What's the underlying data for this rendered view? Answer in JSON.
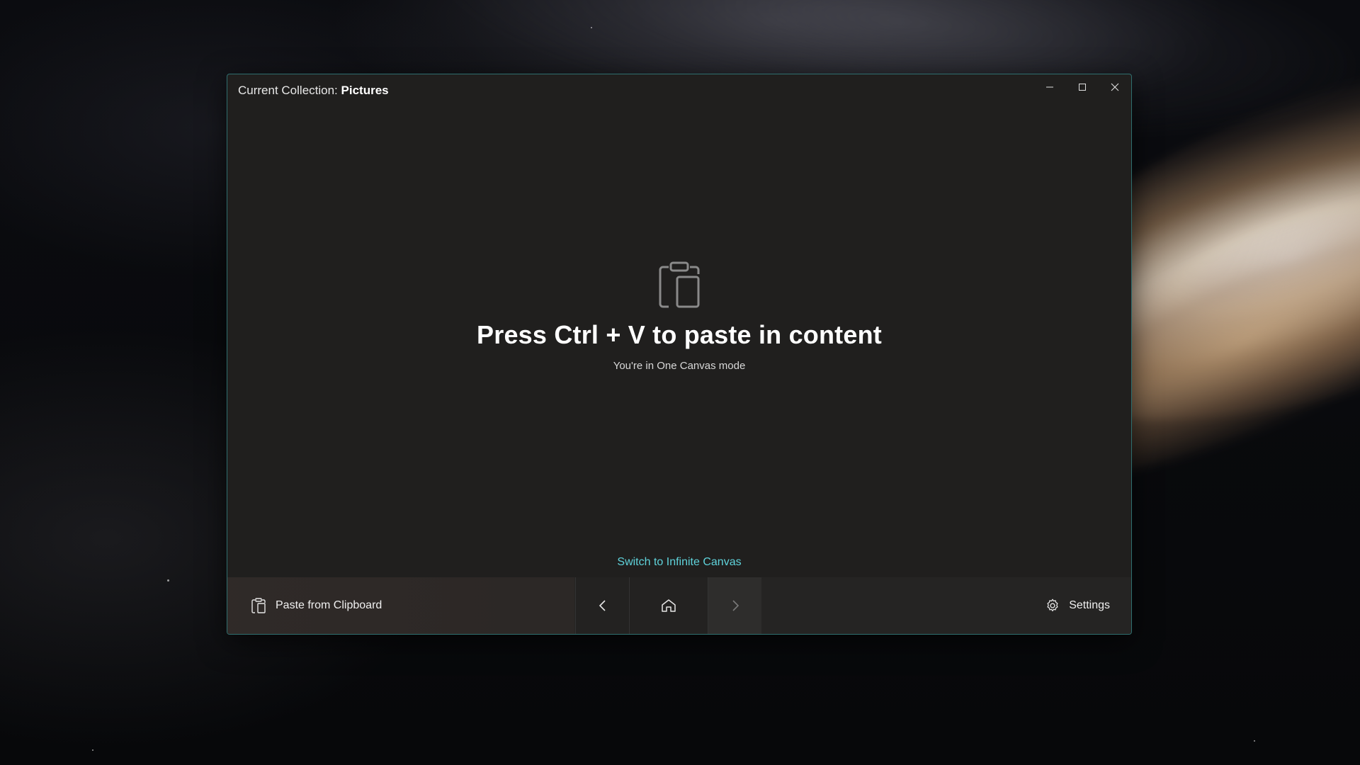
{
  "window": {
    "title_prefix": "Current Collection:",
    "title_collection": "Pictures"
  },
  "caption": {
    "minimize_icon": "minimize-icon",
    "maximize_icon": "maximize-icon",
    "close_icon": "close-icon"
  },
  "empty_state": {
    "icon": "clipboard-icon",
    "headline": "Press Ctrl + V to paste in content",
    "subline": "You're in One Canvas mode",
    "switch_link": "Switch to Infinite Canvas"
  },
  "bottombar": {
    "paste_label": "Paste from Clipboard",
    "paste_icon": "clipboard-icon",
    "back_icon": "chevron-left-icon",
    "home_icon": "home-icon",
    "forward_icon": "chevron-right-icon",
    "settings_label": "Settings",
    "settings_icon": "gear-icon"
  },
  "colors": {
    "accent": "#5fd3db",
    "window_bg": "#201f1e",
    "window_border": "#2f6f6f"
  }
}
